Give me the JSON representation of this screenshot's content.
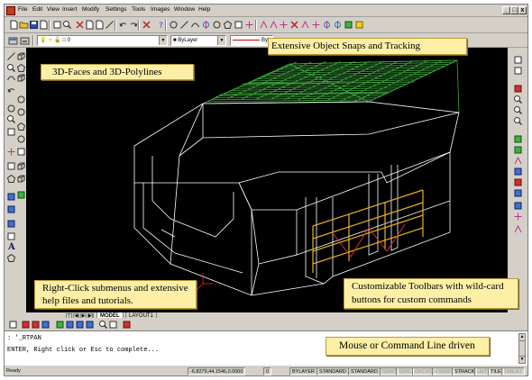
{
  "menu": {
    "items": [
      "File",
      "Edit",
      "View",
      "Insert",
      "Modify",
      "Settings",
      "Tools",
      "Images",
      "Window",
      "Help"
    ]
  },
  "window_controls": [
    "_",
    "□",
    "x"
  ],
  "properties_bar": {
    "layer_value": "0",
    "color_value": "ByLayer",
    "linetype_value": "ByL"
  },
  "callouts": {
    "snaps": "Extensive Object Snaps and Tracking",
    "faces": "3D-Faces and 3D-Polylines",
    "rightclick": "Right-Click submenus and extensive help files and tutorials.",
    "toolbars": "Customizable Toolbars with wild-card buttons for custom commands",
    "cmdline": "Mouse or Command Line driven"
  },
  "tabs": {
    "model": "MODEL",
    "layout1": "LAYOUT1"
  },
  "command": {
    "line1": ": '_RTPAN",
    "line2": "ENTER, Right click or Esc to complete..."
  },
  "status": {
    "ready": "Ready",
    "coords": "-6.8279,44.1546,0.0000",
    "elev": "0",
    "layer": "BYLAYER",
    "textstyle": "STANDARD",
    "dimstyle": "STANDARD",
    "toggles": [
      {
        "label": "SNAP",
        "on": false
      },
      {
        "label": "GRID",
        "on": false
      },
      {
        "label": "ORTHO",
        "on": false
      },
      {
        "label": "ESNAP",
        "on": false
      },
      {
        "label": "STRACK",
        "on": true
      },
      {
        "label": "LWT",
        "on": false
      },
      {
        "label": "TILE",
        "on": true
      },
      {
        "label": "TABLET",
        "on": false
      }
    ]
  },
  "colors": {
    "drawing_background": "#000000",
    "wireframe": "#ffffff",
    "roof_faces": "#3faa3f",
    "rails": "#e8b020",
    "rails_accent": "#d03030",
    "callout_fill": "#fdf0a6"
  },
  "icons": {
    "toolbar_row1": [
      "new-icon",
      "open-icon",
      "save-icon",
      "cut-icon",
      "print-icon",
      "preview-icon",
      "scissors-icon",
      "copy-icon",
      "paste-icon",
      "matchprop-icon",
      "undo-icon",
      "redo-icon",
      "cancel-icon",
      "help-icon",
      "circle-icon",
      "line-icon",
      "arc-icon",
      "center-icon",
      "ellipse-icon",
      "polygon-icon",
      "rectangle-icon",
      "point-icon",
      "snap-end-icon",
      "snap-mid-icon",
      "snap-perp-icon",
      "snap-int-icon",
      "snap-tan-icon",
      "snap-ins-icon",
      "snap-node-icon",
      "snap-quad-icon",
      "snap-near-icon",
      "snap-clear-icon"
    ]
  }
}
